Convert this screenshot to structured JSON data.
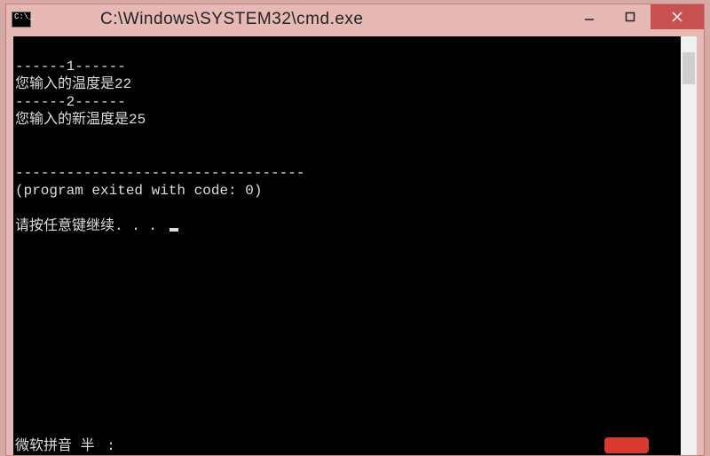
{
  "window": {
    "title": "C:\\Windows\\SYSTEM32\\cmd.exe"
  },
  "console": {
    "lines": [
      "------1------",
      "您输入的温度是22",
      "------2------",
      "您输入的新温度是25",
      "",
      "",
      "----------------------------------",
      "(program exited with code: 0)",
      "",
      "请按任意键继续. . . "
    ]
  },
  "ime": {
    "method": "微软拼音",
    "width": "半 :"
  }
}
